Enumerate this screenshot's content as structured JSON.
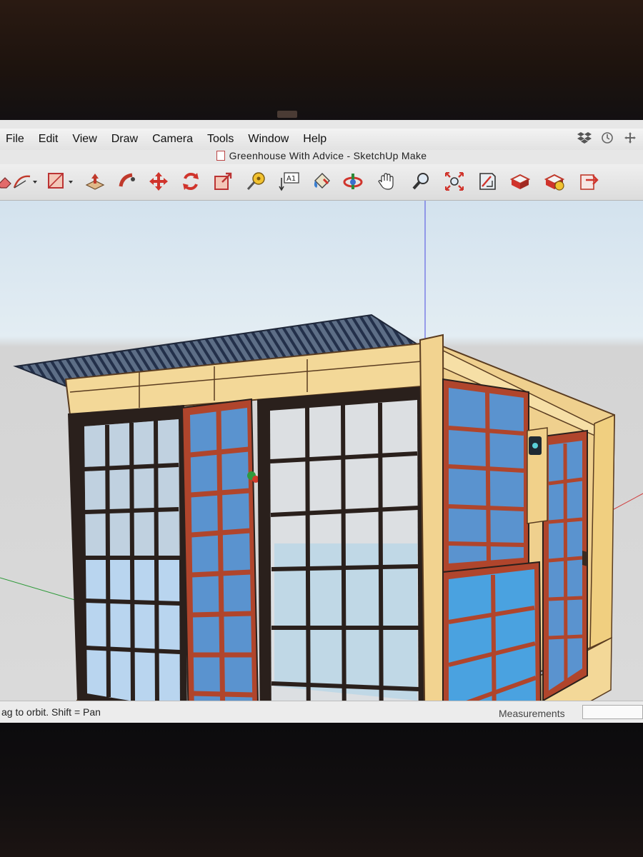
{
  "menu": {
    "items": [
      "File",
      "Edit",
      "View",
      "Draw",
      "Camera",
      "Tools",
      "Window",
      "Help"
    ]
  },
  "system_icons": [
    "dropbox-icon",
    "time-machine-icon",
    "move-icon"
  ],
  "window": {
    "title": "Greenhouse With Advice - SketchUp Make"
  },
  "toolbar": {
    "tools": [
      "eraser-tool",
      "arc-tool",
      "rectangle-tool",
      "push-pull-tool",
      "follow-me-tool",
      "move-tool",
      "rotate-tool",
      "scale-tool",
      "tape-measure-tool",
      "text-tool",
      "paint-bucket-tool",
      "orbit-tool",
      "pan-tool",
      "zoom-tool",
      "zoom-extents-tool",
      "section-plane-tool",
      "warehouse-tool",
      "extension-warehouse-tool",
      "send-to-layout-tool"
    ]
  },
  "status": {
    "hint": "ag to orbit.  Shift = Pan",
    "measurements_label": "Measurements",
    "measurements_value": ""
  },
  "colors": {
    "frame_red": "#b0452c",
    "frame_dark": "#2a201c",
    "wood": "#f1d594",
    "glass": "#5a93cf",
    "roof": "#3d4a5e"
  }
}
